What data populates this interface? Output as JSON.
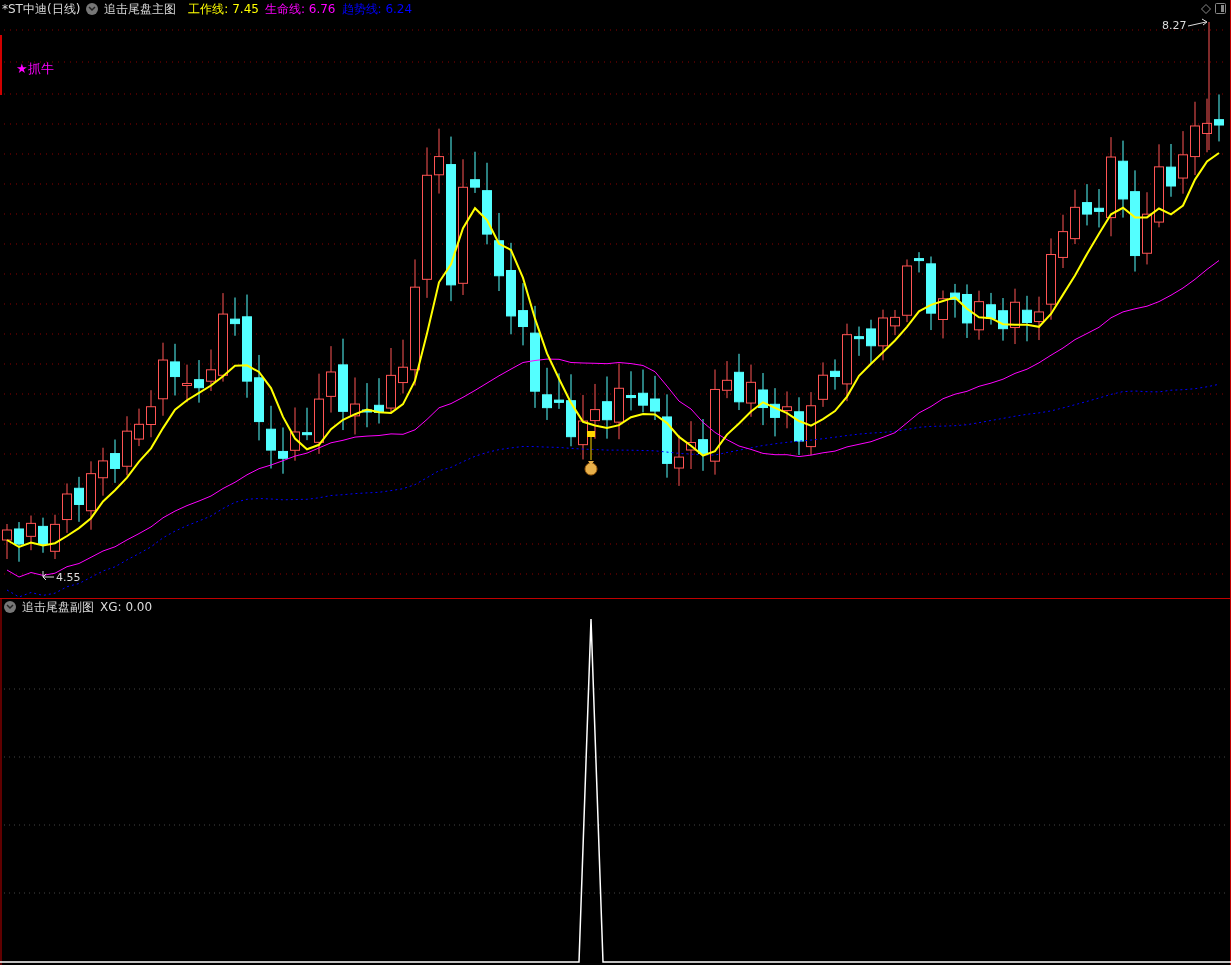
{
  "header": {
    "stock": "*ST中迪(日线)",
    "indicator": "追击尾盘主图",
    "lines": [
      {
        "label": "工作线:",
        "value": "7.45",
        "color": "#ffff00"
      },
      {
        "label": "生命线:",
        "value": "6.76",
        "color": "#ff00ff"
      },
      {
        "label": "趋势线:",
        "value": "6.24",
        "color": "#0000ff"
      }
    ]
  },
  "signal_label": "★抓牛",
  "high_marker": "8.27",
  "low_marker": "4.55",
  "sub": {
    "title": "追击尾盘副图",
    "readout": "XG: 0.00"
  }
}
